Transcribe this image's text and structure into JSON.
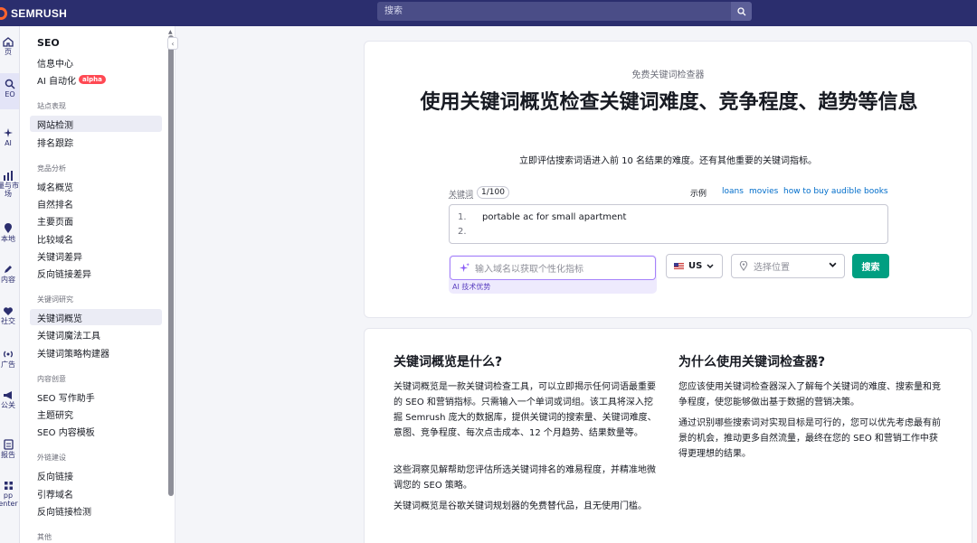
{
  "app": {
    "logo_text": "SEMRUSH"
  },
  "search": {
    "placeholder": "搜索"
  },
  "rail": [
    {
      "label": "页",
      "icon": "home-icon"
    },
    {
      "label": "EO",
      "icon": "seo-icon"
    },
    {
      "label": "AI",
      "icon": "ai-sparkle-icon"
    },
    {
      "label": "量与市\n场",
      "icon": "chart-icon"
    },
    {
      "label": "本地",
      "icon": "location-icon"
    },
    {
      "label": "内容",
      "icon": "pen-icon"
    },
    {
      "label": "社交",
      "icon": "heart-icon"
    },
    {
      "label": "广告",
      "icon": "broadcast-icon"
    },
    {
      "label": "公关",
      "icon": "megaphone-icon"
    },
    {
      "label": "报告",
      "icon": "report-icon"
    },
    {
      "label": "pp\nenter",
      "icon": "grid-icon"
    }
  ],
  "sidebar": {
    "title": "SEO",
    "items": {
      "info_center": "信息中心",
      "ai_auto": "AI 自动化",
      "alpha": "alpha",
      "sec_site": "站点表现",
      "site_audit": "网站检测",
      "rank_track": "排名跟踪",
      "sec_comp": "竞品分析",
      "domain_overview": "域名概览",
      "organic": "自然排名",
      "top_pages": "主要页面",
      "compare_domains": "比较域名",
      "kw_gap": "关键词差异",
      "backlink_gap": "反向链接差异",
      "sec_kw": "关键词研究",
      "kw_overview": "关键词概览",
      "kw_magic": "关键词魔法工具",
      "kw_strategy": "关键词策略构建器",
      "sec_content": "内容创意",
      "seo_writing": "SEO 写作助手",
      "topic_research": "主题研究",
      "seo_template": "SEO 内容模板",
      "sec_links": "外链建设",
      "backlinks": "反向链接",
      "ref_domains": "引荐域名",
      "backlink_audit": "反向链接检测",
      "sec_other": "其他"
    }
  },
  "hero": {
    "eyebrow": "免费关键词检查器",
    "headline": "使用关键词概览检查关键词难度、竞争程度、趋势等信息",
    "subline": "立即评估搜索词语进入前 10 名结果的难度。还有其他重要的关键词指标。",
    "kw_label": "关键词",
    "kw_count": "1/100",
    "examples_label": "示例",
    "examples": [
      "loans",
      "movies",
      "how to buy audible books"
    ],
    "kw_lines": [
      {
        "num": "1.",
        "text": "portable ac for small apartment"
      },
      {
        "num": "2.",
        "text": ""
      }
    ],
    "domain_placeholder": "输入域名以获取个性化指标",
    "ai_badge": "AI 技术优势",
    "country": "US",
    "location_placeholder": "选择位置",
    "search_button": "搜索"
  },
  "info": {
    "left_title": "关键词概览是什么?",
    "left_p1": "关键词概览是一款关键词检查工具，可以立即揭示任何词语最重要的 SEO 和营销指标。只需输入一个单词或词组。该工具将深入挖掘 Semrush 庞大的数据库，提供关键词的搜索量、关键词难度、意图、竞争程度、每次点击成本、12 个月趋势、结果数量等。",
    "left_p2": "这些洞察见解帮助您评估所选关键词排名的难易程度，并精准地微调您的 SEO 策略。",
    "left_p3": "关键词概览是谷歌关键词规划器的免费替代品，且无使用门槛。",
    "right_title": "为什么使用关键词检查器?",
    "right_p1": "您应该使用关键词检查器深入了解每个关键词的难度、搜索量和竞争程度，使您能够做出基于数据的营销决策。",
    "right_p2": "通过识别哪些搜索词对实现目标是可行的，您可以优先考虑最有前景的机会，推动更多自然流量，最终在您的 SEO 和营销工作中获得更理想的结果。"
  },
  "colors": {
    "topbar": "#2b2e6e",
    "accent_green": "#009f81",
    "link": "#006dca",
    "alpha_badge": "#ff4953"
  }
}
